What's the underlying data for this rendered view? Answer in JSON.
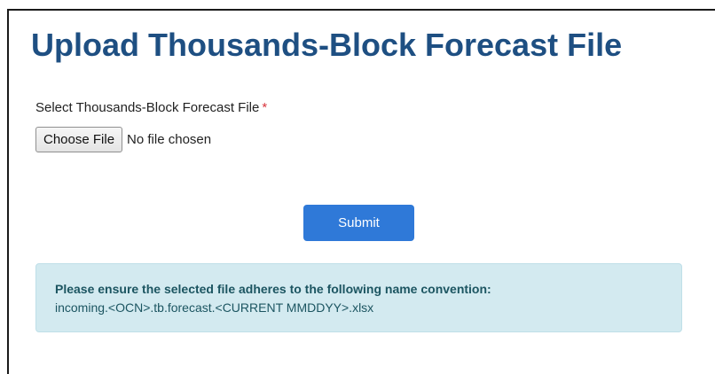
{
  "page": {
    "title": "Upload Thousands-Block Forecast File"
  },
  "form": {
    "file_label": "Select Thousands-Block Forecast File",
    "required_marker": "*",
    "choose_file_label": "Choose File",
    "file_status": "No file chosen",
    "submit_label": "Submit"
  },
  "alert": {
    "heading": "Please ensure the selected file adheres to the following name convention:",
    "body": "incoming.<OCN>.tb.forecast.<CURRENT MMDDYY>.xlsx"
  },
  "colors": {
    "title": "#1e4f82",
    "submit_background": "#2f79d8",
    "alert_background": "#d3eaf0",
    "alert_text": "#1c5561",
    "required": "#d9363e"
  }
}
